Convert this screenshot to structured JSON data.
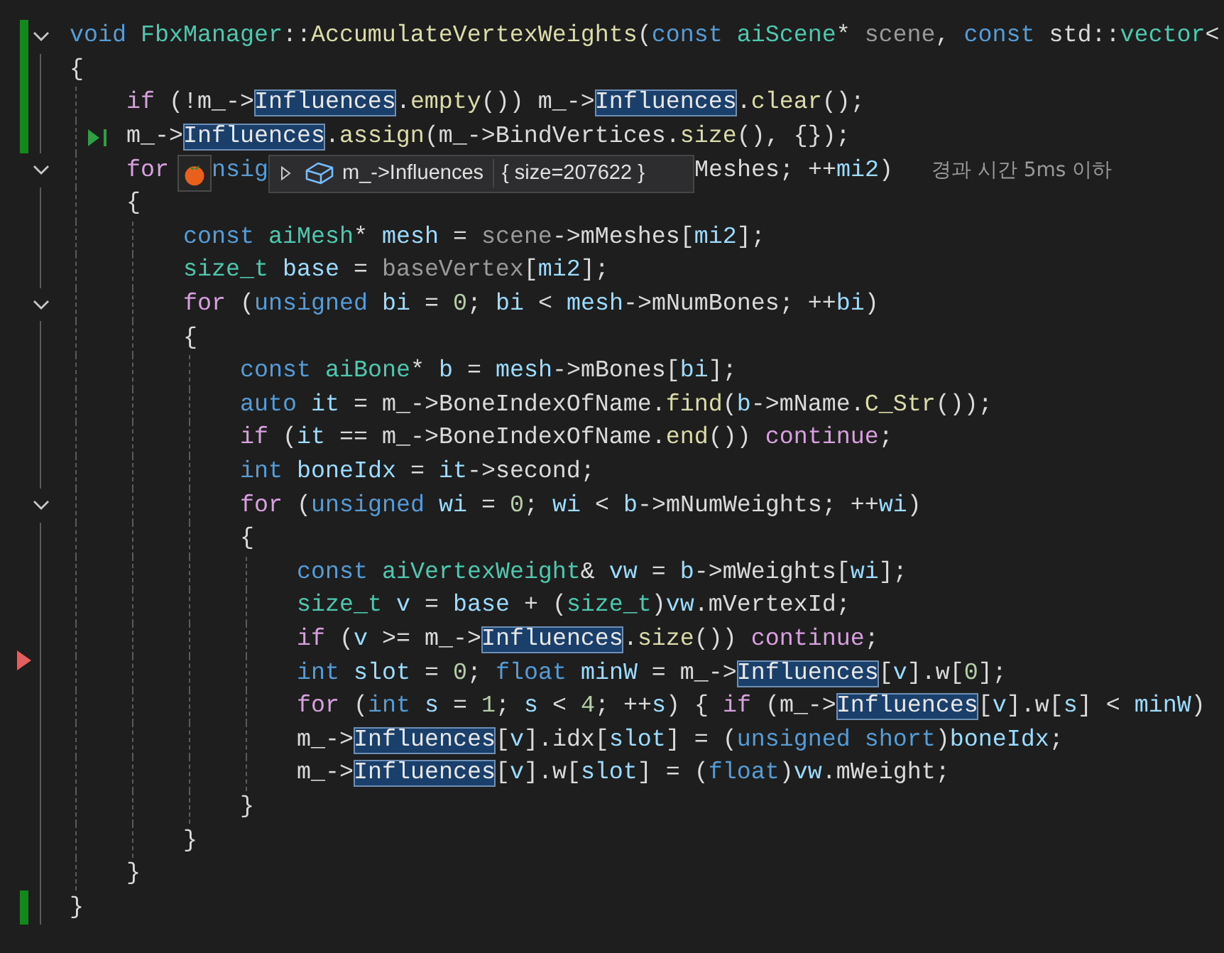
{
  "lines": [
    {
      "changed": true,
      "fold": true,
      "arrow": false,
      "run_to_click": false,
      "code": [
        {
          "text": "void ",
          "kind": "kw"
        },
        {
          "text": "FbxManager",
          "kind": "type"
        },
        {
          "text": "::",
          "kind": "plain"
        },
        {
          "text": "AccumulateVertexWeights",
          "kind": "fn"
        },
        {
          "text": "(",
          "kind": "plain"
        },
        {
          "text": "const ",
          "kind": "kw"
        },
        {
          "text": "aiScene",
          "kind": "type"
        },
        {
          "text": "* ",
          "kind": "plain"
        },
        {
          "text": "scene",
          "kind": "param"
        },
        {
          "text": ", ",
          "kind": "plain"
        },
        {
          "text": "const",
          "kind": "kw"
        },
        {
          "text": " std::",
          "kind": "plain"
        },
        {
          "text": "vector",
          "kind": "type"
        },
        {
          "text": "<",
          "kind": "plain"
        }
      ]
    },
    {
      "changed": true,
      "fold": false,
      "arrow": false,
      "run_to_click": false,
      "code": [
        {
          "text": "{",
          "kind": "plain"
        }
      ],
      "children": [
        {
          "changed": true,
          "fold": false,
          "arrow": false,
          "run_to_click": false,
          "code": [
            {
              "text": "if",
              "kind": "ctl"
            },
            {
              "text": " (!m_->",
              "kind": "plain"
            },
            {
              "text": "Influences",
              "kind": "hl"
            },
            {
              "text": ".",
              "kind": "plain"
            },
            {
              "text": "empty",
              "kind": "fn"
            },
            {
              "text": "()) m_->",
              "kind": "plain"
            },
            {
              "text": "Influences",
              "kind": "hl"
            },
            {
              "text": ".",
              "kind": "plain"
            },
            {
              "text": "clear",
              "kind": "fn"
            },
            {
              "text": "();",
              "kind": "plain"
            }
          ]
        },
        {
          "changed": true,
          "fold": false,
          "arrow": false,
          "run_to_click": true,
          "code": [
            {
              "text": "m_->",
              "kind": "plain"
            },
            {
              "text": "Influences",
              "kind": "hl"
            },
            {
              "text": ".",
              "kind": "plain"
            },
            {
              "text": "assign",
              "kind": "fn"
            },
            {
              "text": "(m_->BindVertices.",
              "kind": "plain"
            },
            {
              "text": "size",
              "kind": "fn"
            },
            {
              "text": "(), {});",
              "kind": "plain"
            }
          ]
        },
        {
          "changed": false,
          "fold": true,
          "arrow": false,
          "run_to_click": false,
          "segments": [
            {
              "kind": "code",
              "tokens": [
                {
                  "text": "for",
                  "kind": "ctl"
                }
              ]
            },
            {
              "kind": "tomato"
            },
            {
              "kind": "code",
              "tokens": [
                {
                  "text": "nsig",
                  "kind": "kw"
                }
              ]
            },
            {
              "kind": "datatip",
              "expression": "m_->Influences",
              "value": "{ size=207622 }"
            },
            {
              "kind": "code",
              "tokens": [
                {
                  "text": "Meshes; ++",
                  "kind": "plain"
                },
                {
                  "text": "mi2",
                  "kind": "var"
                },
                {
                  "text": ")",
                  "kind": "plain"
                }
              ]
            },
            {
              "kind": "hint",
              "text": "경과 시간 5ms 이하"
            }
          ]
        },
        {
          "changed": false,
          "fold": false,
          "arrow": false,
          "run_to_click": false,
          "code": [
            {
              "text": "{",
              "kind": "plain"
            }
          ],
          "children": [
            {
              "changed": false,
              "fold": false,
              "arrow": false,
              "run_to_click": false,
              "code": [
                {
                  "text": "const ",
                  "kind": "kw"
                },
                {
                  "text": "aiMesh",
                  "kind": "type"
                },
                {
                  "text": "* ",
                  "kind": "plain"
                },
                {
                  "text": "mesh",
                  "kind": "var"
                },
                {
                  "text": " = ",
                  "kind": "plain"
                },
                {
                  "text": "scene",
                  "kind": "param"
                },
                {
                  "text": "->mMeshes[",
                  "kind": "plain"
                },
                {
                  "text": "mi2",
                  "kind": "var"
                },
                {
                  "text": "];",
                  "kind": "plain"
                }
              ]
            },
            {
              "changed": false,
              "fold": false,
              "arrow": false,
              "run_to_click": false,
              "code": [
                {
                  "text": "size_t ",
                  "kind": "type"
                },
                {
                  "text": "base",
                  "kind": "var"
                },
                {
                  "text": " = ",
                  "kind": "plain"
                },
                {
                  "text": "baseVertex",
                  "kind": "param"
                },
                {
                  "text": "[",
                  "kind": "plain"
                },
                {
                  "text": "mi2",
                  "kind": "var"
                },
                {
                  "text": "];",
                  "kind": "plain"
                }
              ]
            },
            {
              "changed": false,
              "fold": true,
              "arrow": false,
              "run_to_click": false,
              "code": [
                {
                  "text": "for",
                  "kind": "ctl"
                },
                {
                  "text": " (",
                  "kind": "plain"
                },
                {
                  "text": "unsigned ",
                  "kind": "kw"
                },
                {
                  "text": "bi",
                  "kind": "var"
                },
                {
                  "text": " = ",
                  "kind": "plain"
                },
                {
                  "text": "0",
                  "kind": "num"
                },
                {
                  "text": "; ",
                  "kind": "plain"
                },
                {
                  "text": "bi",
                  "kind": "var"
                },
                {
                  "text": " < ",
                  "kind": "plain"
                },
                {
                  "text": "mesh",
                  "kind": "var"
                },
                {
                  "text": "->mNumBones; ++",
                  "kind": "plain"
                },
                {
                  "text": "bi",
                  "kind": "var"
                },
                {
                  "text": ")",
                  "kind": "plain"
                }
              ]
            },
            {
              "changed": false,
              "fold": false,
              "arrow": false,
              "run_to_click": false,
              "code": [
                {
                  "text": "{",
                  "kind": "plain"
                }
              ],
              "children": [
                {
                  "changed": false,
                  "fold": false,
                  "arrow": false,
                  "run_to_click": false,
                  "code": [
                    {
                      "text": "const ",
                      "kind": "kw"
                    },
                    {
                      "text": "aiBone",
                      "kind": "type"
                    },
                    {
                      "text": "* ",
                      "kind": "plain"
                    },
                    {
                      "text": "b",
                      "kind": "var"
                    },
                    {
                      "text": " = ",
                      "kind": "plain"
                    },
                    {
                      "text": "mesh",
                      "kind": "var"
                    },
                    {
                      "text": "->mBones[",
                      "kind": "plain"
                    },
                    {
                      "text": "bi",
                      "kind": "var"
                    },
                    {
                      "text": "];",
                      "kind": "plain"
                    }
                  ]
                },
                {
                  "changed": false,
                  "fold": false,
                  "arrow": false,
                  "run_to_click": false,
                  "code": [
                    {
                      "text": "auto ",
                      "kind": "kw"
                    },
                    {
                      "text": "it",
                      "kind": "var"
                    },
                    {
                      "text": " = m_->BoneIndexOfName.",
                      "kind": "plain"
                    },
                    {
                      "text": "find",
                      "kind": "fn"
                    },
                    {
                      "text": "(",
                      "kind": "plain"
                    },
                    {
                      "text": "b",
                      "kind": "var"
                    },
                    {
                      "text": "->mName.",
                      "kind": "plain"
                    },
                    {
                      "text": "C_Str",
                      "kind": "fn"
                    },
                    {
                      "text": "());",
                      "kind": "plain"
                    }
                  ]
                },
                {
                  "changed": false,
                  "fold": false,
                  "arrow": false,
                  "run_to_click": false,
                  "code": [
                    {
                      "text": "if",
                      "kind": "ctl"
                    },
                    {
                      "text": " (",
                      "kind": "plain"
                    },
                    {
                      "text": "it",
                      "kind": "var"
                    },
                    {
                      "text": " == m_->BoneIndexOfName.",
                      "kind": "plain"
                    },
                    {
                      "text": "end",
                      "kind": "fn"
                    },
                    {
                      "text": "()) ",
                      "kind": "plain"
                    },
                    {
                      "text": "continue",
                      "kind": "ctl"
                    },
                    {
                      "text": ";",
                      "kind": "plain"
                    }
                  ]
                },
                {
                  "changed": false,
                  "fold": false,
                  "arrow": false,
                  "run_to_click": false,
                  "code": [
                    {
                      "text": "int ",
                      "kind": "kw"
                    },
                    {
                      "text": "boneIdx",
                      "kind": "var"
                    },
                    {
                      "text": " = ",
                      "kind": "plain"
                    },
                    {
                      "text": "it",
                      "kind": "var"
                    },
                    {
                      "text": "->second;",
                      "kind": "plain"
                    }
                  ]
                },
                {
                  "changed": false,
                  "fold": true,
                  "arrow": false,
                  "run_to_click": false,
                  "code": [
                    {
                      "text": "for",
                      "kind": "ctl"
                    },
                    {
                      "text": " (",
                      "kind": "plain"
                    },
                    {
                      "text": "unsigned ",
                      "kind": "kw"
                    },
                    {
                      "text": "wi",
                      "kind": "var"
                    },
                    {
                      "text": " = ",
                      "kind": "plain"
                    },
                    {
                      "text": "0",
                      "kind": "num"
                    },
                    {
                      "text": "; ",
                      "kind": "plain"
                    },
                    {
                      "text": "wi",
                      "kind": "var"
                    },
                    {
                      "text": " < ",
                      "kind": "plain"
                    },
                    {
                      "text": "b",
                      "kind": "var"
                    },
                    {
                      "text": "->mNumWeights; ++",
                      "kind": "plain"
                    },
                    {
                      "text": "wi",
                      "kind": "var"
                    },
                    {
                      "text": ")",
                      "kind": "plain"
                    }
                  ]
                },
                {
                  "changed": false,
                  "fold": false,
                  "arrow": false,
                  "run_to_click": false,
                  "code": [
                    {
                      "text": "{",
                      "kind": "plain"
                    }
                  ],
                  "children": [
                    {
                      "changed": false,
                      "fold": false,
                      "arrow": false,
                      "run_to_click": false,
                      "code": [
                        {
                          "text": "const ",
                          "kind": "kw"
                        },
                        {
                          "text": "aiVertexWeight",
                          "kind": "type"
                        },
                        {
                          "text": "& ",
                          "kind": "plain"
                        },
                        {
                          "text": "vw",
                          "kind": "var"
                        },
                        {
                          "text": " = ",
                          "kind": "plain"
                        },
                        {
                          "text": "b",
                          "kind": "var"
                        },
                        {
                          "text": "->mWeights[",
                          "kind": "plain"
                        },
                        {
                          "text": "wi",
                          "kind": "var"
                        },
                        {
                          "text": "];",
                          "kind": "plain"
                        }
                      ]
                    },
                    {
                      "changed": false,
                      "fold": false,
                      "arrow": false,
                      "run_to_click": false,
                      "code": [
                        {
                          "text": "size_t ",
                          "kind": "type"
                        },
                        {
                          "text": "v",
                          "kind": "var"
                        },
                        {
                          "text": " = ",
                          "kind": "plain"
                        },
                        {
                          "text": "base",
                          "kind": "var"
                        },
                        {
                          "text": " + (",
                          "kind": "plain"
                        },
                        {
                          "text": "size_t",
                          "kind": "type"
                        },
                        {
                          "text": ")",
                          "kind": "plain"
                        },
                        {
                          "text": "vw",
                          "kind": "var"
                        },
                        {
                          "text": ".mVertexId;",
                          "kind": "plain"
                        }
                      ]
                    },
                    {
                      "changed": false,
                      "fold": false,
                      "arrow": false,
                      "run_to_click": false,
                      "code": [
                        {
                          "text": "if",
                          "kind": "ctl"
                        },
                        {
                          "text": " (",
                          "kind": "plain"
                        },
                        {
                          "text": "v",
                          "kind": "var"
                        },
                        {
                          "text": " >= m_->",
                          "kind": "plain"
                        },
                        {
                          "text": "Influences",
                          "kind": "hl"
                        },
                        {
                          "text": ".",
                          "kind": "plain"
                        },
                        {
                          "text": "size",
                          "kind": "fn"
                        },
                        {
                          "text": "()) ",
                          "kind": "plain"
                        },
                        {
                          "text": "continue",
                          "kind": "ctl"
                        },
                        {
                          "text": ";",
                          "kind": "plain"
                        }
                      ]
                    },
                    {
                      "changed": false,
                      "fold": false,
                      "arrow": true,
                      "run_to_click": false,
                      "code": [
                        {
                          "text": "int ",
                          "kind": "kw"
                        },
                        {
                          "text": "slot",
                          "kind": "var"
                        },
                        {
                          "text": " = ",
                          "kind": "plain"
                        },
                        {
                          "text": "0",
                          "kind": "num"
                        },
                        {
                          "text": "; ",
                          "kind": "plain"
                        },
                        {
                          "text": "float ",
                          "kind": "kw"
                        },
                        {
                          "text": "minW",
                          "kind": "var"
                        },
                        {
                          "text": " = m_->",
                          "kind": "plain"
                        },
                        {
                          "text": "Influences",
                          "kind": "hl"
                        },
                        {
                          "text": "[",
                          "kind": "plain"
                        },
                        {
                          "text": "v",
                          "kind": "var"
                        },
                        {
                          "text": "].w[",
                          "kind": "plain"
                        },
                        {
                          "text": "0",
                          "kind": "num"
                        },
                        {
                          "text": "];",
                          "kind": "plain"
                        }
                      ]
                    },
                    {
                      "changed": false,
                      "fold": false,
                      "arrow": false,
                      "run_to_click": false,
                      "code": [
                        {
                          "text": "for",
                          "kind": "ctl"
                        },
                        {
                          "text": " (",
                          "kind": "plain"
                        },
                        {
                          "text": "int ",
                          "kind": "kw"
                        },
                        {
                          "text": "s",
                          "kind": "var"
                        },
                        {
                          "text": " = ",
                          "kind": "plain"
                        },
                        {
                          "text": "1",
                          "kind": "num"
                        },
                        {
                          "text": "; ",
                          "kind": "plain"
                        },
                        {
                          "text": "s",
                          "kind": "var"
                        },
                        {
                          "text": " < ",
                          "kind": "plain"
                        },
                        {
                          "text": "4",
                          "kind": "num"
                        },
                        {
                          "text": "; ++",
                          "kind": "plain"
                        },
                        {
                          "text": "s",
                          "kind": "var"
                        },
                        {
                          "text": ") { ",
                          "kind": "plain"
                        },
                        {
                          "text": "if",
                          "kind": "ctl"
                        },
                        {
                          "text": " (m_->",
                          "kind": "plain"
                        },
                        {
                          "text": "Influences",
                          "kind": "hl"
                        },
                        {
                          "text": "[",
                          "kind": "plain"
                        },
                        {
                          "text": "v",
                          "kind": "var"
                        },
                        {
                          "text": "].w[",
                          "kind": "plain"
                        },
                        {
                          "text": "s",
                          "kind": "var"
                        },
                        {
                          "text": "] < ",
                          "kind": "plain"
                        },
                        {
                          "text": "minW",
                          "kind": "var"
                        },
                        {
                          "text": ")",
                          "kind": "plain"
                        }
                      ]
                    },
                    {
                      "changed": false,
                      "fold": false,
                      "arrow": false,
                      "run_to_click": false,
                      "code": [
                        {
                          "text": "m_->",
                          "kind": "plain"
                        },
                        {
                          "text": "Influences",
                          "kind": "hl"
                        },
                        {
                          "text": "[",
                          "kind": "plain"
                        },
                        {
                          "text": "v",
                          "kind": "var"
                        },
                        {
                          "text": "].idx[",
                          "kind": "plain"
                        },
                        {
                          "text": "slot",
                          "kind": "var"
                        },
                        {
                          "text": "] = (",
                          "kind": "plain"
                        },
                        {
                          "text": "unsigned short",
                          "kind": "kw"
                        },
                        {
                          "text": ")",
                          "kind": "plain"
                        },
                        {
                          "text": "boneIdx",
                          "kind": "var"
                        },
                        {
                          "text": ";",
                          "kind": "plain"
                        }
                      ]
                    },
                    {
                      "changed": false,
                      "fold": false,
                      "arrow": false,
                      "run_to_click": false,
                      "code": [
                        {
                          "text": "m_->",
                          "kind": "plain"
                        },
                        {
                          "text": "Influences",
                          "kind": "hl"
                        },
                        {
                          "text": "[",
                          "kind": "plain"
                        },
                        {
                          "text": "v",
                          "kind": "var"
                        },
                        {
                          "text": "].w[",
                          "kind": "plain"
                        },
                        {
                          "text": "slot",
                          "kind": "var"
                        },
                        {
                          "text": "] = (",
                          "kind": "plain"
                        },
                        {
                          "text": "float",
                          "kind": "kw"
                        },
                        {
                          "text": ")",
                          "kind": "plain"
                        },
                        {
                          "text": "vw",
                          "kind": "var"
                        },
                        {
                          "text": ".mWeight;",
                          "kind": "plain"
                        }
                      ]
                    }
                  ]
                },
                {
                  "changed": false,
                  "fold": false,
                  "arrow": false,
                  "run_to_click": false,
                  "code": [
                    {
                      "text": "}",
                      "kind": "plain"
                    }
                  ]
                }
              ]
            },
            {
              "changed": false,
              "fold": false,
              "arrow": false,
              "run_to_click": false,
              "code": [
                {
                  "text": "}",
                  "kind": "plain"
                }
              ]
            }
          ]
        },
        {
          "changed": false,
          "fold": false,
          "arrow": false,
          "run_to_click": false,
          "code": [
            {
              "text": "}",
              "kind": "plain"
            }
          ]
        }
      ]
    },
    {
      "changed": true,
      "fold": false,
      "arrow": false,
      "run_to_click": false,
      "code": [
        {
          "text": "}",
          "kind": "plain"
        }
      ]
    }
  ]
}
